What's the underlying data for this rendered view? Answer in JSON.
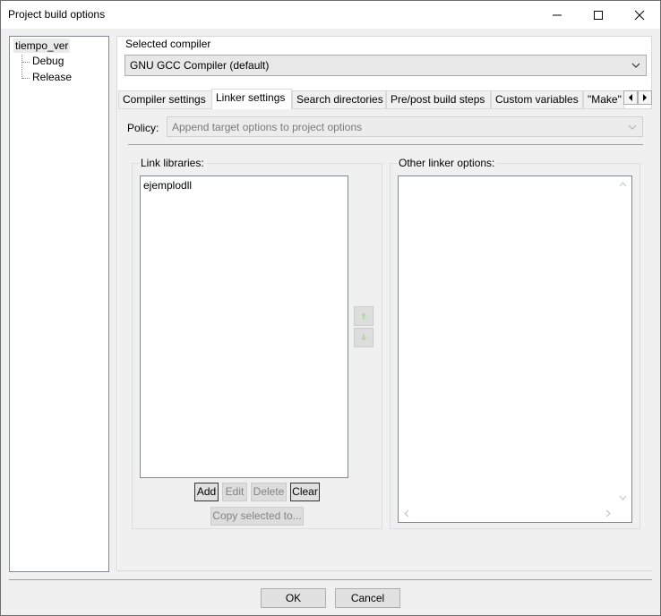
{
  "window": {
    "title": "Project build options",
    "controls": {
      "minimize": "minimize-icon",
      "maximize": "maximize-icon",
      "close": "close-icon"
    }
  },
  "tree": {
    "root": "tiempo_ver",
    "children": [
      "Debug",
      "Release"
    ]
  },
  "compiler": {
    "label": "Selected compiler",
    "value": "GNU GCC Compiler (default)"
  },
  "tabs": [
    {
      "label": "Compiler settings",
      "active": false
    },
    {
      "label": "Linker settings",
      "active": true
    },
    {
      "label": "Search directories",
      "active": false
    },
    {
      "label": "Pre/post build steps",
      "active": false
    },
    {
      "label": "Custom variables",
      "active": false
    },
    {
      "label": "\"Make\"",
      "active": false
    }
  ],
  "policy": {
    "label": "Policy:",
    "value": "Append target options to project options",
    "enabled": false
  },
  "link_libraries": {
    "label": "Link libraries:",
    "items": [
      "ejemplodll"
    ],
    "buttons": {
      "add": "Add",
      "edit": "Edit",
      "delete": "Delete",
      "clear": "Clear",
      "copy": "Copy selected to..."
    }
  },
  "other_linker_options": {
    "label": "Other linker options:",
    "value": ""
  },
  "dialog_buttons": {
    "ok": "OK",
    "cancel": "Cancel"
  }
}
